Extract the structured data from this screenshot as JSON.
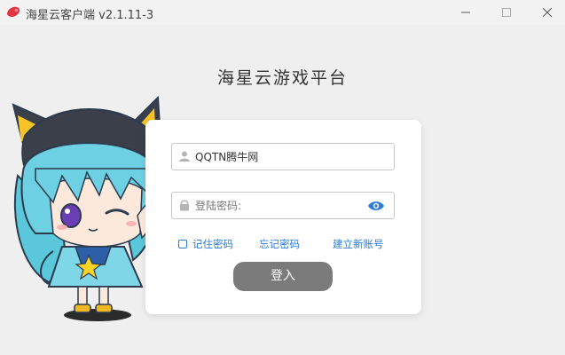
{
  "window": {
    "title": "海星云客户端 v2.1.11-3",
    "controls": [
      "minimize",
      "maximize",
      "close"
    ]
  },
  "header": {
    "title": "海星云游戏平台"
  },
  "login": {
    "username_value": "QQTN腾牛网",
    "password_placeholder": "登陆密码:",
    "remember_label": "记住密码",
    "forgot_label": "忘记密码",
    "register_label": "建立新账号",
    "submit_label": "登入"
  },
  "icons": {
    "username": "user-icon",
    "password": "lock-icon",
    "show_password": "eye-icon",
    "app": "app-logo-icon"
  },
  "colors": {
    "accent": "#2a7ad6",
    "button": "#7b7b7b",
    "background": "#efefef"
  }
}
